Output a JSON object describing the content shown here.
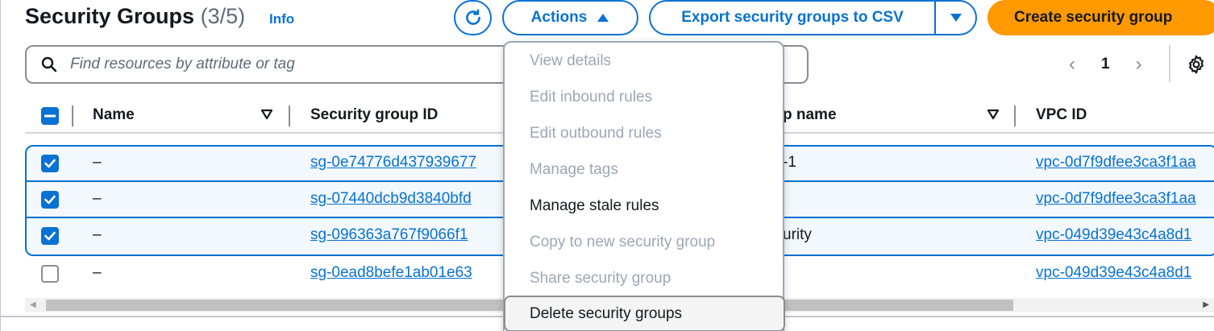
{
  "header": {
    "title": "Security Groups",
    "count": "(3/5)",
    "info": "Info",
    "actions_label": "Actions",
    "export_label": "Export security groups to CSV",
    "create_label": "Create security group"
  },
  "search": {
    "placeholder": "Find resources by attribute or tag"
  },
  "pagination": {
    "current_page": "1"
  },
  "table": {
    "columns": [
      "Name",
      "Security group ID",
      "p name",
      "VPC ID"
    ],
    "rows": [
      {
        "name": "–",
        "group_id": "sg-0e74776d437939677",
        "group_name": "-1",
        "vpc_id": "vpc-0d7f9dfee3ca3f1aa",
        "selected": true
      },
      {
        "name": "–",
        "group_id": "sg-07440dcb9d3840bfd",
        "group_name": "",
        "vpc_id": "vpc-0d7f9dfee3ca3f1aa",
        "selected": true
      },
      {
        "name": "–",
        "group_id": "sg-096363a767f9066f1",
        "group_name": "urity",
        "vpc_id": "vpc-049d39e43c4a8d1",
        "selected": true
      },
      {
        "name": "–",
        "group_id": "sg-0ead8befe1ab01e63",
        "group_name": "",
        "vpc_id": "vpc-049d39e43c4a8d1",
        "selected": false
      }
    ]
  },
  "actions_menu": {
    "items": [
      {
        "label": "View details",
        "enabled": false
      },
      {
        "label": "Edit inbound rules",
        "enabled": false
      },
      {
        "label": "Edit outbound rules",
        "enabled": false
      },
      {
        "label": "Manage tags",
        "enabled": false
      },
      {
        "label": "Manage stale rules",
        "enabled": true
      },
      {
        "label": "Copy to new security group",
        "enabled": false
      },
      {
        "label": "Share security group",
        "enabled": false
      },
      {
        "label": "Delete security groups",
        "enabled": true,
        "highlighted": true
      }
    ]
  },
  "colors": {
    "accent": "#0972d3",
    "primary_button": "#ff9900",
    "disabled_text": "#9ba7b6",
    "selected_row_bg": "#f2f8fd"
  }
}
